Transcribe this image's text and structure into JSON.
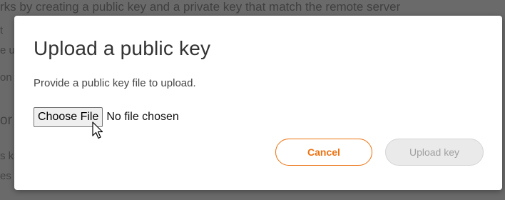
{
  "background": {
    "line_1": "rks by creating a public key and a private key that match the remote server",
    "fragments": [
      "t",
      "e u",
      "on",
      "or",
      "s k",
      "es"
    ]
  },
  "modal": {
    "title": "Upload a public key",
    "description": "Provide a public key file to upload.",
    "file_input": {
      "button_label": "Choose File",
      "status": "No file chosen"
    },
    "cancel_label": "Cancel",
    "upload_label": "Upload key"
  },
  "colors": {
    "accent": "#ec7211",
    "disabled_bg": "#eaeaea",
    "disabled_text": "#a0a0a0"
  },
  "icons": {
    "cursor": "arrow-pointer-icon"
  }
}
